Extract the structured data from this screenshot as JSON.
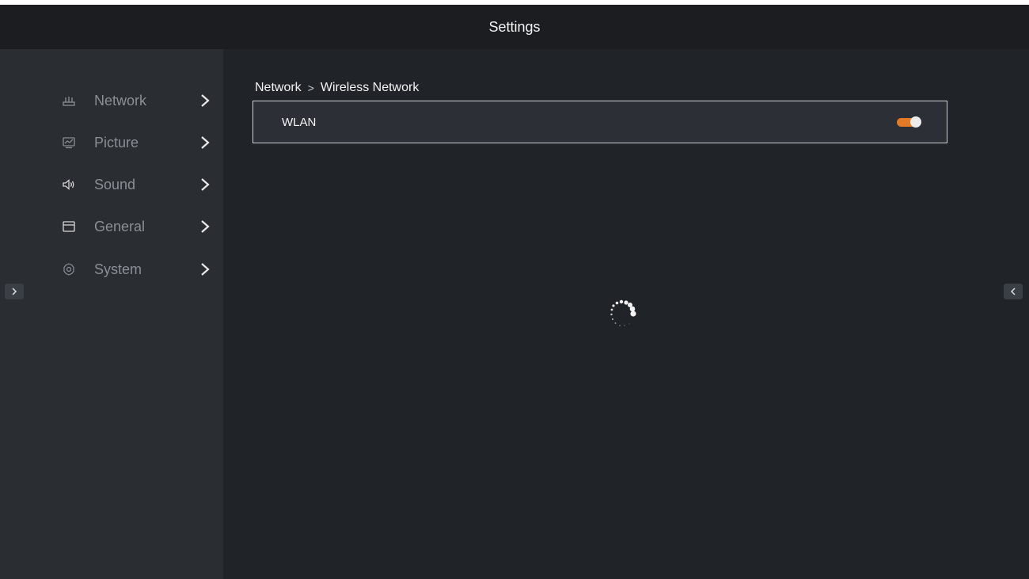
{
  "header": {
    "title": "Settings"
  },
  "sidebar": {
    "items": [
      {
        "label": "Network",
        "icon": "router-icon"
      },
      {
        "label": "Picture",
        "icon": "picture-icon"
      },
      {
        "label": "Sound",
        "icon": "speaker-icon"
      },
      {
        "label": "General",
        "icon": "window-icon"
      },
      {
        "label": "System",
        "icon": "gear-icon"
      }
    ]
  },
  "breadcrumb": {
    "parent": "Network",
    "separator": ">",
    "current": "Wireless Network"
  },
  "wlan": {
    "label": "WLAN",
    "enabled": true
  },
  "status": {
    "loading": true
  },
  "colors": {
    "accent": "#e37a25",
    "background": "#202428",
    "sidebar": "#2a2e33",
    "topbar": "#1b1d20"
  }
}
